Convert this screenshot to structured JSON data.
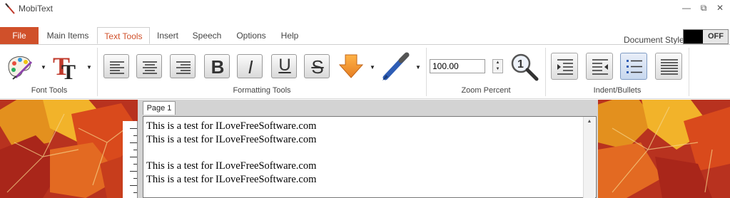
{
  "app": {
    "title": "MobiText",
    "minimize": "—",
    "restore": "⧉",
    "close": "✕"
  },
  "ribbon_tabs": {
    "file": "File",
    "tabs": [
      "Main Items",
      "Text Tools",
      "Insert",
      "Speech",
      "Options",
      "Help"
    ],
    "active": "Text Tools"
  },
  "document_style": {
    "label": "Document Style:",
    "toggle_text": "OFF"
  },
  "groups": {
    "font_tools": "Font Tools",
    "formatting_tools": "Formatting Tools",
    "zoom_percent": "Zoom Percent",
    "indent_bullets": "Indent/Bullets"
  },
  "formatting": {
    "bold": "B",
    "italic": "I",
    "underline": "U",
    "strike": "S"
  },
  "zoom": {
    "value": "100.00"
  },
  "editor": {
    "page_tab": "Page 1",
    "lines": [
      "This is a test for ILoveFreeSoftware.com",
      "This is a test for ILoveFreeSoftware.com",
      "",
      "This is a test for ILoveFreeSoftware.com",
      "This is a test for ILoveFreeSoftware.com"
    ]
  },
  "colors": {
    "accent": "#d0502a",
    "active_tab_text": "#d0502a",
    "highlight_arrow": "#f39c12",
    "pen": "#2e5db5"
  }
}
